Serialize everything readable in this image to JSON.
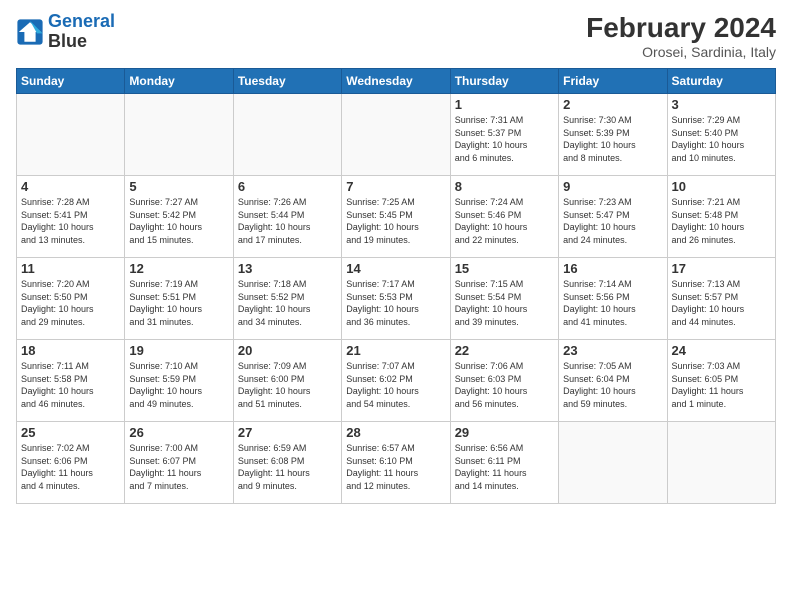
{
  "header": {
    "logo_line1": "General",
    "logo_line2": "Blue",
    "title": "February 2024",
    "subtitle": "Orosei, Sardinia, Italy"
  },
  "days_of_week": [
    "Sunday",
    "Monday",
    "Tuesday",
    "Wednesday",
    "Thursday",
    "Friday",
    "Saturday"
  ],
  "weeks": [
    [
      {
        "num": "",
        "info": ""
      },
      {
        "num": "",
        "info": ""
      },
      {
        "num": "",
        "info": ""
      },
      {
        "num": "",
        "info": ""
      },
      {
        "num": "1",
        "info": "Sunrise: 7:31 AM\nSunset: 5:37 PM\nDaylight: 10 hours\nand 6 minutes."
      },
      {
        "num": "2",
        "info": "Sunrise: 7:30 AM\nSunset: 5:39 PM\nDaylight: 10 hours\nand 8 minutes."
      },
      {
        "num": "3",
        "info": "Sunrise: 7:29 AM\nSunset: 5:40 PM\nDaylight: 10 hours\nand 10 minutes."
      }
    ],
    [
      {
        "num": "4",
        "info": "Sunrise: 7:28 AM\nSunset: 5:41 PM\nDaylight: 10 hours\nand 13 minutes."
      },
      {
        "num": "5",
        "info": "Sunrise: 7:27 AM\nSunset: 5:42 PM\nDaylight: 10 hours\nand 15 minutes."
      },
      {
        "num": "6",
        "info": "Sunrise: 7:26 AM\nSunset: 5:44 PM\nDaylight: 10 hours\nand 17 minutes."
      },
      {
        "num": "7",
        "info": "Sunrise: 7:25 AM\nSunset: 5:45 PM\nDaylight: 10 hours\nand 19 minutes."
      },
      {
        "num": "8",
        "info": "Sunrise: 7:24 AM\nSunset: 5:46 PM\nDaylight: 10 hours\nand 22 minutes."
      },
      {
        "num": "9",
        "info": "Sunrise: 7:23 AM\nSunset: 5:47 PM\nDaylight: 10 hours\nand 24 minutes."
      },
      {
        "num": "10",
        "info": "Sunrise: 7:21 AM\nSunset: 5:48 PM\nDaylight: 10 hours\nand 26 minutes."
      }
    ],
    [
      {
        "num": "11",
        "info": "Sunrise: 7:20 AM\nSunset: 5:50 PM\nDaylight: 10 hours\nand 29 minutes."
      },
      {
        "num": "12",
        "info": "Sunrise: 7:19 AM\nSunset: 5:51 PM\nDaylight: 10 hours\nand 31 minutes."
      },
      {
        "num": "13",
        "info": "Sunrise: 7:18 AM\nSunset: 5:52 PM\nDaylight: 10 hours\nand 34 minutes."
      },
      {
        "num": "14",
        "info": "Sunrise: 7:17 AM\nSunset: 5:53 PM\nDaylight: 10 hours\nand 36 minutes."
      },
      {
        "num": "15",
        "info": "Sunrise: 7:15 AM\nSunset: 5:54 PM\nDaylight: 10 hours\nand 39 minutes."
      },
      {
        "num": "16",
        "info": "Sunrise: 7:14 AM\nSunset: 5:56 PM\nDaylight: 10 hours\nand 41 minutes."
      },
      {
        "num": "17",
        "info": "Sunrise: 7:13 AM\nSunset: 5:57 PM\nDaylight: 10 hours\nand 44 minutes."
      }
    ],
    [
      {
        "num": "18",
        "info": "Sunrise: 7:11 AM\nSunset: 5:58 PM\nDaylight: 10 hours\nand 46 minutes."
      },
      {
        "num": "19",
        "info": "Sunrise: 7:10 AM\nSunset: 5:59 PM\nDaylight: 10 hours\nand 49 minutes."
      },
      {
        "num": "20",
        "info": "Sunrise: 7:09 AM\nSunset: 6:00 PM\nDaylight: 10 hours\nand 51 minutes."
      },
      {
        "num": "21",
        "info": "Sunrise: 7:07 AM\nSunset: 6:02 PM\nDaylight: 10 hours\nand 54 minutes."
      },
      {
        "num": "22",
        "info": "Sunrise: 7:06 AM\nSunset: 6:03 PM\nDaylight: 10 hours\nand 56 minutes."
      },
      {
        "num": "23",
        "info": "Sunrise: 7:05 AM\nSunset: 6:04 PM\nDaylight: 10 hours\nand 59 minutes."
      },
      {
        "num": "24",
        "info": "Sunrise: 7:03 AM\nSunset: 6:05 PM\nDaylight: 11 hours\nand 1 minute."
      }
    ],
    [
      {
        "num": "25",
        "info": "Sunrise: 7:02 AM\nSunset: 6:06 PM\nDaylight: 11 hours\nand 4 minutes."
      },
      {
        "num": "26",
        "info": "Sunrise: 7:00 AM\nSunset: 6:07 PM\nDaylight: 11 hours\nand 7 minutes."
      },
      {
        "num": "27",
        "info": "Sunrise: 6:59 AM\nSunset: 6:08 PM\nDaylight: 11 hours\nand 9 minutes."
      },
      {
        "num": "28",
        "info": "Sunrise: 6:57 AM\nSunset: 6:10 PM\nDaylight: 11 hours\nand 12 minutes."
      },
      {
        "num": "29",
        "info": "Sunrise: 6:56 AM\nSunset: 6:11 PM\nDaylight: 11 hours\nand 14 minutes."
      },
      {
        "num": "",
        "info": ""
      },
      {
        "num": "",
        "info": ""
      }
    ]
  ]
}
